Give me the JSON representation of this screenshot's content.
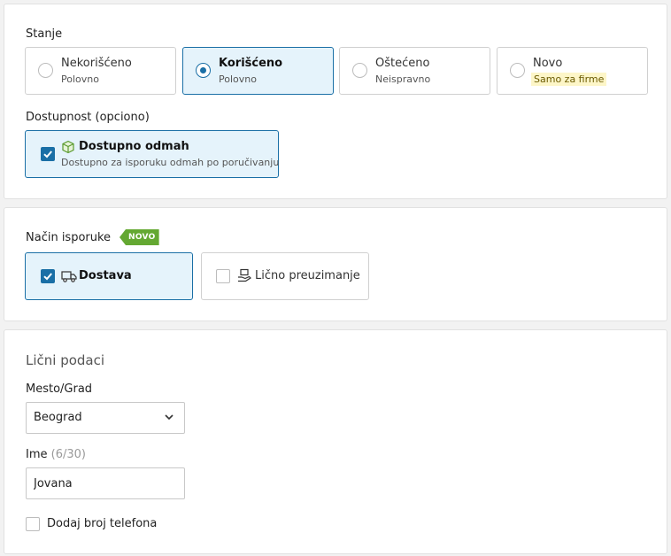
{
  "stanje": {
    "label": "Stanje",
    "options": [
      {
        "title": "Nekorišćeno",
        "sub": "Polovno",
        "selected": false
      },
      {
        "title": "Korišćeno",
        "sub": "Polovno",
        "selected": true
      },
      {
        "title": "Oštećeno",
        "sub": "Neispravno",
        "selected": false
      },
      {
        "title": "Novo",
        "sub": "Samo za firme",
        "selected": false
      }
    ]
  },
  "dostupnost": {
    "label": "Dostupnost  (opciono)",
    "option": {
      "title": "Dostupno odmah",
      "sub": "Dostupno za isporuku odmah po poručivanju",
      "checked": true
    }
  },
  "isporuka": {
    "label": "Način isporuke",
    "badge": "NOVO",
    "options": [
      {
        "title": "Dostava",
        "checked": true
      },
      {
        "title": "Lično preuzimanje",
        "checked": false
      }
    ]
  },
  "licni": {
    "title": "Lični podaci",
    "city_label": "Mesto/Grad",
    "city_value": "Beograd",
    "name_label": "Ime",
    "name_counter": "(6/30)",
    "name_value": "Jovana",
    "phone_label": "Dodaj broj telefona",
    "phone_checked": false
  },
  "colors": {
    "accent": "#1a6fa6",
    "selected_bg": "#e5f3fb",
    "new_badge": "#64a832"
  }
}
